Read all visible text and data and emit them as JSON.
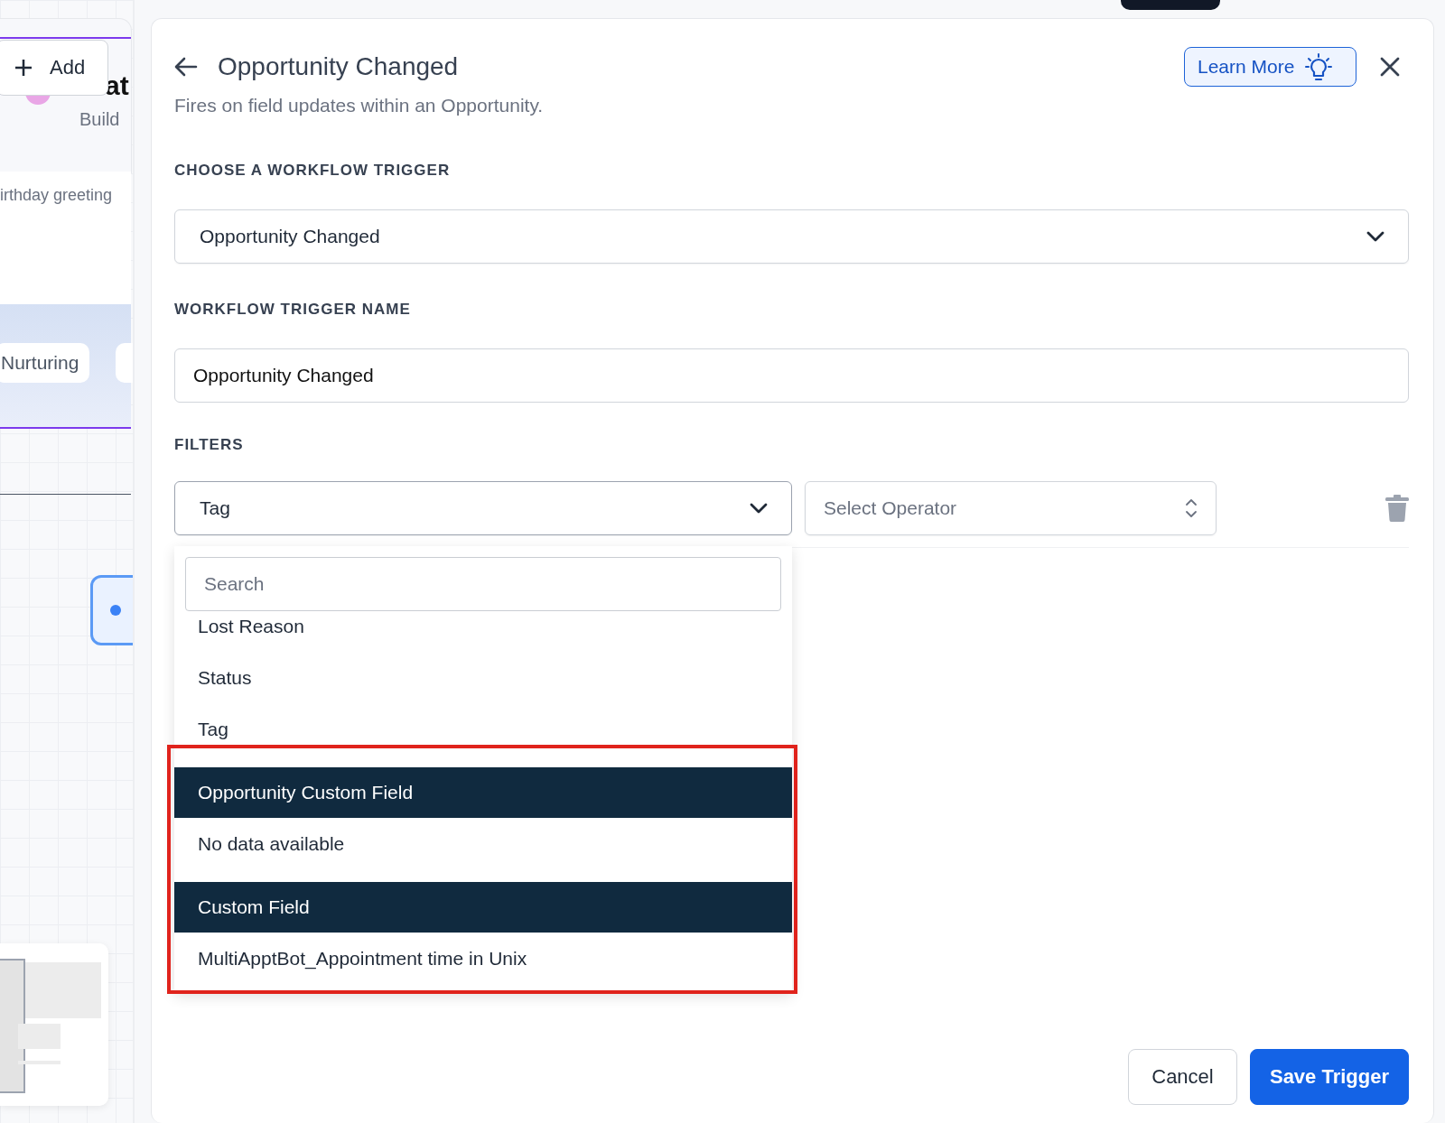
{
  "background_canvas": {
    "add_button": "Add",
    "title_fragment": "at",
    "subtitle_fragment": "Build",
    "description_fragment": "irthday greeting",
    "tags": [
      "Nurturing"
    ]
  },
  "panel": {
    "title": "Opportunity Changed",
    "description": "Fires on field updates within an Opportunity.",
    "learn_more": "Learn More",
    "trigger_section": {
      "label": "CHOOSE A WORKFLOW TRIGGER",
      "value": "Opportunity Changed"
    },
    "name_section": {
      "label": "WORKFLOW TRIGGER NAME",
      "value": "Opportunity Changed"
    },
    "filters": {
      "label": "FILTERS",
      "field": {
        "value": "Tag",
        "expanded": true
      },
      "operator": {
        "placeholder": "Select Operator"
      },
      "dropdown": {
        "search_placeholder": "Search",
        "options": [
          {
            "kind": "option",
            "label": "Lost Reason"
          },
          {
            "kind": "option",
            "label": "Status"
          },
          {
            "kind": "option",
            "label": "Tag"
          },
          {
            "kind": "group",
            "label": "Opportunity Custom Field"
          },
          {
            "kind": "empty",
            "label": "No data available"
          },
          {
            "kind": "group",
            "label": "Custom Field"
          },
          {
            "kind": "option",
            "label": "MultiApptBot_Appointment time in Unix"
          }
        ]
      }
    },
    "buttons": [
      {
        "kind": "secondary",
        "label": "Cancel"
      },
      {
        "kind": "primary",
        "label": "Save Trigger"
      }
    ]
  }
}
